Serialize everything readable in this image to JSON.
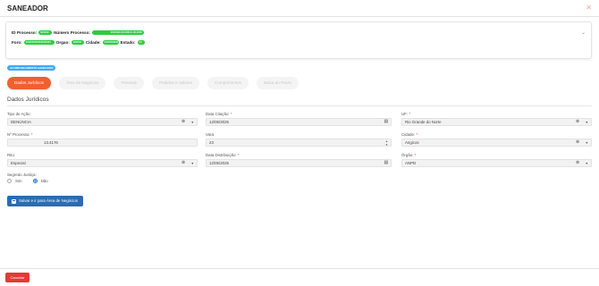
{
  "window": {
    "title": "SANEADOR",
    "close_icon": "close-icon"
  },
  "process_info": {
    "id_label": "ID Processo:",
    "id_value": "000000",
    "numero_label": "Número Processo:",
    "numero_value": "0000000-00.0000.0.00.0000",
    "foro_label": "Foro:",
    "foro_value": "000000000000000000",
    "orgao_label": "Orgao:",
    "orgao_value": "000000",
    "cidade_label": "Cidade:",
    "cidade_value": "0000000000",
    "estado_label": "Estado:",
    "estado_value": "00",
    "expand_icon": "chevron-down-icon"
  },
  "badge": "ACOMPANHAMENTO SANEADOR",
  "tabs": [
    {
      "label": "Dados Jurídicos",
      "active": true
    },
    {
      "label": "Área de Negócios",
      "active": false
    },
    {
      "label": "Pessoas",
      "active": false
    },
    {
      "label": "Pedidos e Valores",
      "active": false
    },
    {
      "label": "Cumprimentos",
      "active": false
    },
    {
      "label": "Baixa do Prazo",
      "active": false
    }
  ],
  "section_title": "Dados Jurídicos",
  "fields": {
    "tipo_acao": {
      "label": "Tipo de Ação:",
      "required": false,
      "value": "DENÚNCIA"
    },
    "data_citacao": {
      "label": "Data Citação:",
      "required": true,
      "value": "12/05/2025"
    },
    "uf": {
      "label": "UF:",
      "required": true,
      "value": "Rio Grande do Norte"
    },
    "num_processo": {
      "label": "Nº Processo:",
      "required": true,
      "value": "13.4176"
    },
    "vara": {
      "label": "Vara:",
      "required": false,
      "value": "23"
    },
    "cidade": {
      "label": "Cidade:",
      "required": true,
      "value": "Angicos"
    },
    "rito": {
      "label": "Rito:",
      "required": false,
      "value": "Especial"
    },
    "data_distribuicao": {
      "label": "Data Distribuição:",
      "required": true,
      "value": "12/05/2025"
    },
    "orgao": {
      "label": "Órgão:",
      "required": true,
      "value": "ANPD"
    }
  },
  "segredo": {
    "label": "Segredo Justiça:",
    "option_sim": "Sim",
    "option_nao": "Não",
    "selected": "Não"
  },
  "save_button": "Salvar e ir para Área de Negócios",
  "cancel_button": "Cancelar",
  "colors": {
    "accent": "#f0602e",
    "primary": "#2b6cb0",
    "danger": "#e53935",
    "success": "#2ecc40",
    "info": "#3fa9f5"
  }
}
